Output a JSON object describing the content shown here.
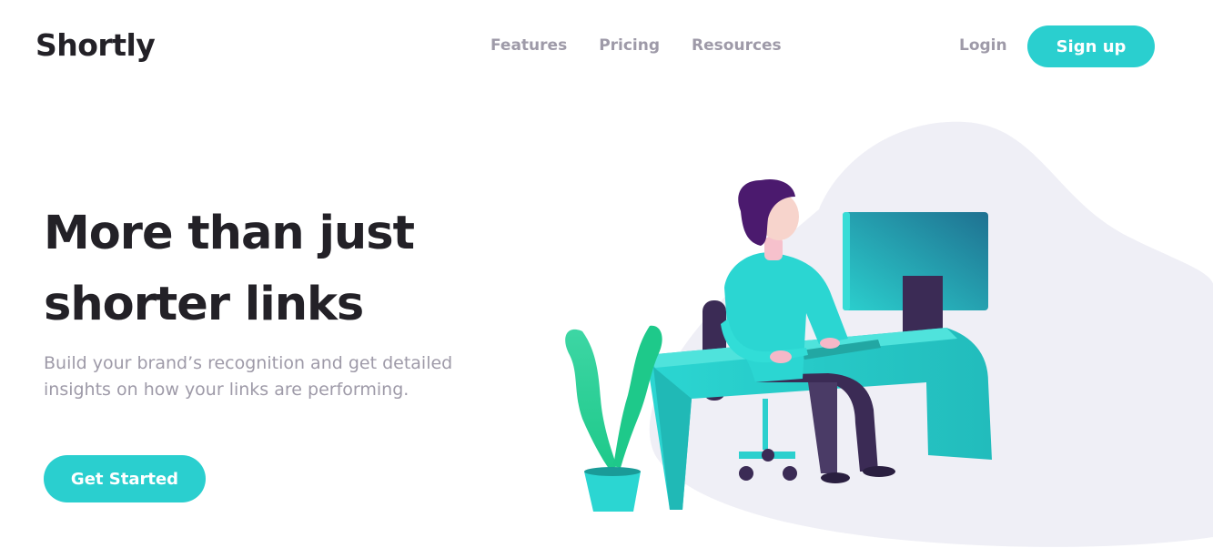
{
  "brand": {
    "name": "Shortly"
  },
  "nav": {
    "items": [
      {
        "label": "Features"
      },
      {
        "label": "Pricing"
      },
      {
        "label": "Resources"
      }
    ],
    "login_label": "Login",
    "signup_label": "Sign up"
  },
  "hero": {
    "title_line1": "More than just",
    "title_line2": "shorter links",
    "subtitle_line1": "Build your brand’s recognition and get detailed",
    "subtitle_line2": "insights on how your links are performing.",
    "cta_label": "Get Started"
  },
  "colors": {
    "accent": "#2acfcf",
    "dark": "#232127",
    "gray": "#9e9aa8",
    "blob": "#efeff6"
  },
  "illustration": {
    "name": "person-working-illustration"
  }
}
